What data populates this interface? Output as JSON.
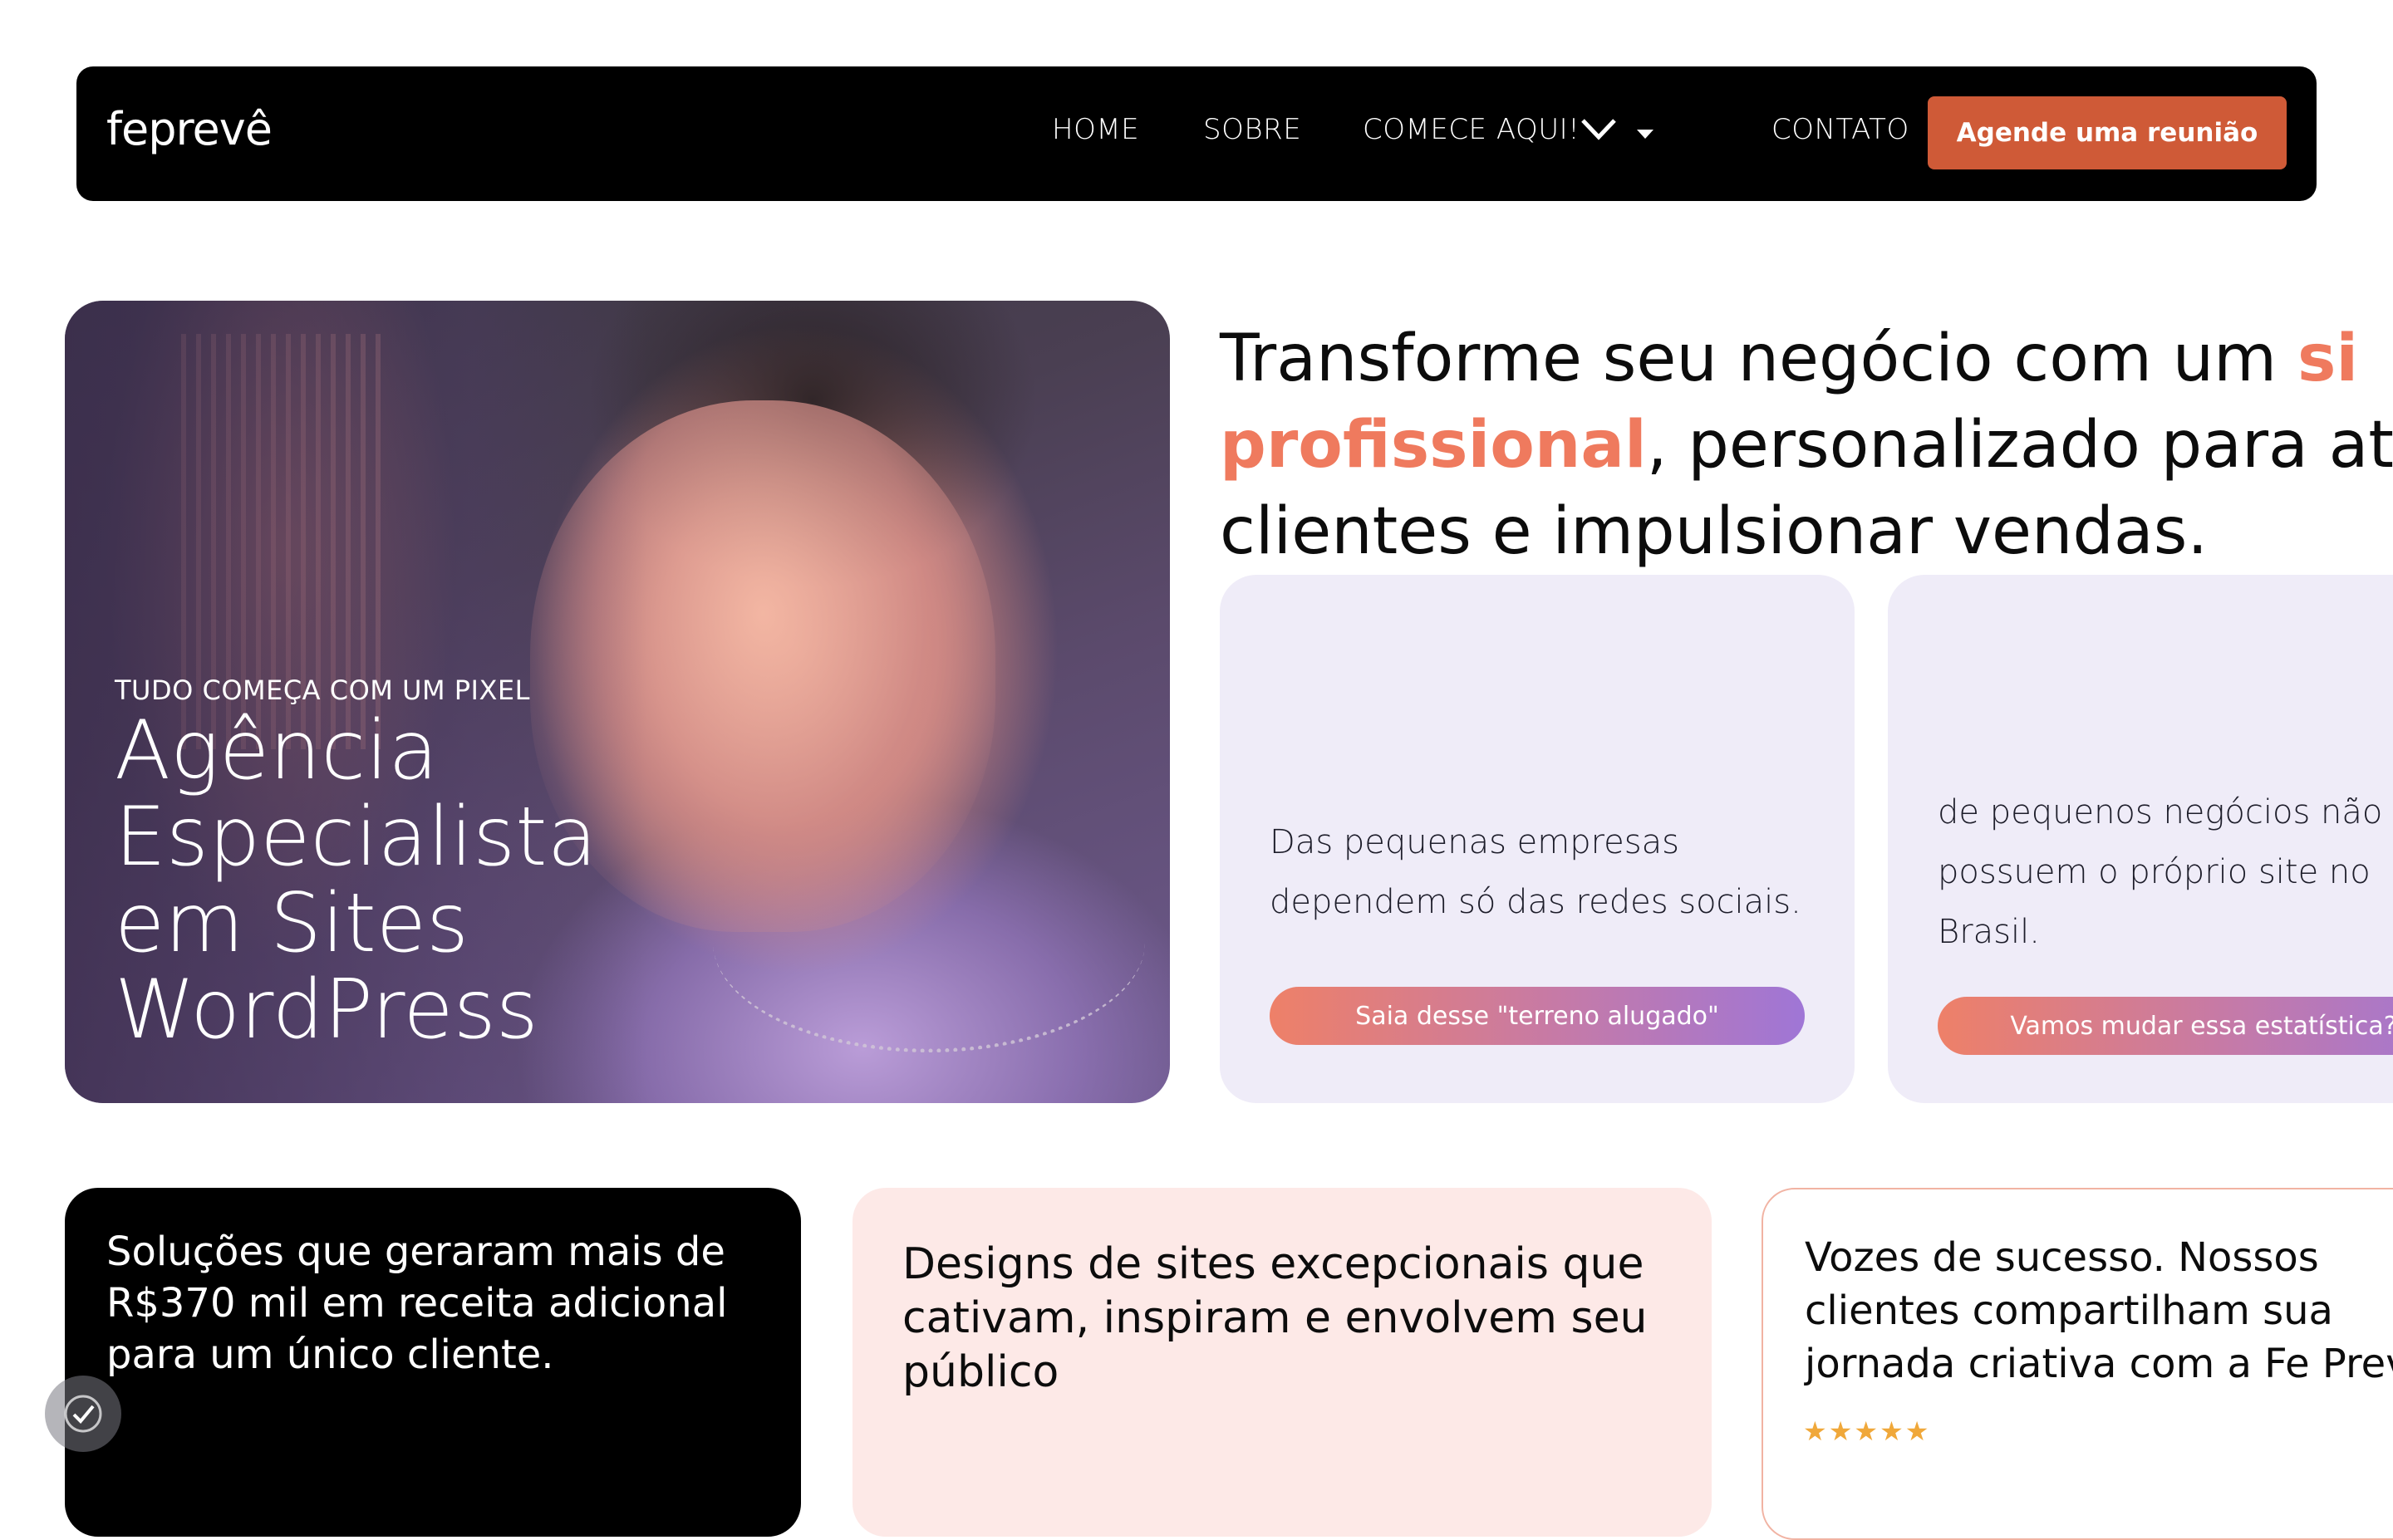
{
  "nav": {
    "logo": "feprevê",
    "links": [
      "HOME",
      "SOBRE",
      "COMECE AQUI!",
      "CONTATO"
    ],
    "cta": "Agende uma reunião"
  },
  "hero": {
    "eyebrow": "TUDO COMEÇA COM UM PIXEL",
    "title": "Agência Especialista em Sites WordPress"
  },
  "headline": {
    "part1": "Transforme seu negócio com um ",
    "accent1": "si",
    "accent2": "profissional",
    "part2": ", personalizado para at",
    "part3": "clientes e impulsionar vendas."
  },
  "stats": [
    {
      "text": "Das pequenas empresas dependem só das redes sociais.",
      "button": "Saia desse \"terreno alugado\""
    },
    {
      "text": "de pequenos negócios não possuem o próprio site no Brasil.",
      "button": "Vamos mudar essa estatística?"
    }
  ],
  "cards": {
    "black": "Soluções que geraram mais de R$370 mil em receita adicional para um único cliente.",
    "pink": "Designs de sites excepcionais que cativam, inspiram e envolvem seu público",
    "white_line1": "Vozes de sucesso. Nossos",
    "white_line2": "clientes compartilham sua",
    "white_line3": "jornada criativa com a Fe Prevê",
    "rating": "★★★★★"
  },
  "colors": {
    "accent": "#ef7a5e",
    "cta": "#cf5a37",
    "stat_bg": "#efecf8",
    "pink_bg": "#fde9e7"
  }
}
